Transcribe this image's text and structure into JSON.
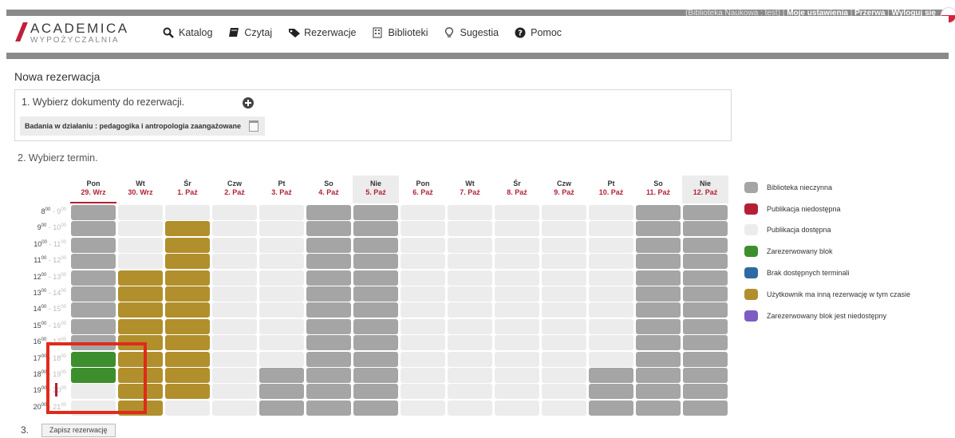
{
  "topbar": {
    "user_info": "(Biblioteka Naukowa : test)",
    "settings_link": "Moje ustawienia",
    "break_link": "Przerwa",
    "logout_link": "Wyloguj się"
  },
  "logo": {
    "title": "ACADEMICA",
    "subtitle": "WYPOŻYCZALNIA"
  },
  "nav": [
    {
      "label": "Katalog",
      "icon": "search-icon"
    },
    {
      "label": "Czytaj",
      "icon": "book-icon"
    },
    {
      "label": "Rezerwacje",
      "icon": "tag-icon"
    },
    {
      "label": "Biblioteki",
      "icon": "building-icon"
    },
    {
      "label": "Sugestia",
      "icon": "lightbulb-icon"
    },
    {
      "label": "Pomoc",
      "icon": "help-icon"
    }
  ],
  "page_title": "Nowa rezerwacja",
  "step1": {
    "label": "1. Wybierz dokumenty do rezerwacji.",
    "document": "Badania w działaniu : pedagogika i antropologia zaangażowane"
  },
  "step2": {
    "label": "2. Wybierz termin."
  },
  "colors": {
    "closed": "#a5a5a5",
    "unavailable": "#b41f36",
    "available": "#ececec",
    "reserved": "#3d8f2d",
    "no_terminals": "#2e6aa3",
    "other_reservation": "#b18f2c",
    "reserved_unavailable": "#7e5cc4"
  },
  "calendar": {
    "days": [
      {
        "name": "Pon",
        "date": "29. Wrz",
        "today": true,
        "weekend": false
      },
      {
        "name": "Wt",
        "date": "30. Wrz",
        "today": false,
        "weekend": false
      },
      {
        "name": "Śr",
        "date": "1. Paź",
        "today": false,
        "weekend": false
      },
      {
        "name": "Czw",
        "date": "2. Paź",
        "today": false,
        "weekend": false
      },
      {
        "name": "Pt",
        "date": "3. Paź",
        "today": false,
        "weekend": false
      },
      {
        "name": "So",
        "date": "4. Paź",
        "today": false,
        "weekend": false
      },
      {
        "name": "Nie",
        "date": "5. Paź",
        "today": false,
        "weekend": true
      },
      {
        "name": "Pon",
        "date": "6. Paź",
        "today": false,
        "weekend": false
      },
      {
        "name": "Wt",
        "date": "7. Paź",
        "today": false,
        "weekend": false
      },
      {
        "name": "Śr",
        "date": "8. Paź",
        "today": false,
        "weekend": false
      },
      {
        "name": "Czw",
        "date": "9. Paź",
        "today": false,
        "weekend": false
      },
      {
        "name": "Pt",
        "date": "10. Paź",
        "today": false,
        "weekend": false
      },
      {
        "name": "So",
        "date": "11. Paź",
        "today": false,
        "weekend": false
      },
      {
        "name": "Nie",
        "date": "12. Paź",
        "today": false,
        "weekend": true
      }
    ],
    "hours": [
      {
        "start": "8",
        "end": "9"
      },
      {
        "start": "9",
        "end": "10"
      },
      {
        "start": "10",
        "end": "11"
      },
      {
        "start": "11",
        "end": "12"
      },
      {
        "start": "12",
        "end": "13"
      },
      {
        "start": "13",
        "end": "14"
      },
      {
        "start": "14",
        "end": "15"
      },
      {
        "start": "15",
        "end": "16"
      },
      {
        "start": "16",
        "end": "17"
      },
      {
        "start": "17",
        "end": "18"
      },
      {
        "start": "18",
        "end": "19"
      },
      {
        "start": "19",
        "end": "20"
      },
      {
        "start": "20",
        "end": "21"
      }
    ],
    "minutes_sup": "00",
    "grid": [
      "CAAAACCAAAAACC",
      "CAOAACCAAAAACC",
      "CAOAACCAAAAACC",
      "CAOAACCAAAAACC",
      "COOAACCAAAAACC",
      "COOAACCAAAAACC",
      "COOAACCAAAAACC",
      "COOAACCAAAAACC",
      "COOAACCAAAAACC",
      "ROOAACCAAAAACC",
      "ROOACCCAAAACCC",
      "AOOACCCAAAACCC",
      "AOAACCCAAAACCC"
    ]
  },
  "legend": [
    {
      "label": "Biblioteka nieczynna",
      "color": "#a5a5a5"
    },
    {
      "label": "Publikacja niedostępna",
      "color": "#b41f36"
    },
    {
      "label": "Publikacja dostępna",
      "color": "#ececec"
    },
    {
      "label": "Zarezerwowany blok",
      "color": "#3d8f2d"
    },
    {
      "label": "Brak dostępnych terminali",
      "color": "#2e6aa3"
    },
    {
      "label": "Użytkownik ma inną rezerwację w tym czasie",
      "color": "#b18f2c"
    },
    {
      "label": "Zarezerwowany blok jest niedostępny",
      "color": "#7e5cc4"
    }
  ],
  "step3": {
    "number": "3.",
    "save_label": "Zapisz rezerwację"
  }
}
